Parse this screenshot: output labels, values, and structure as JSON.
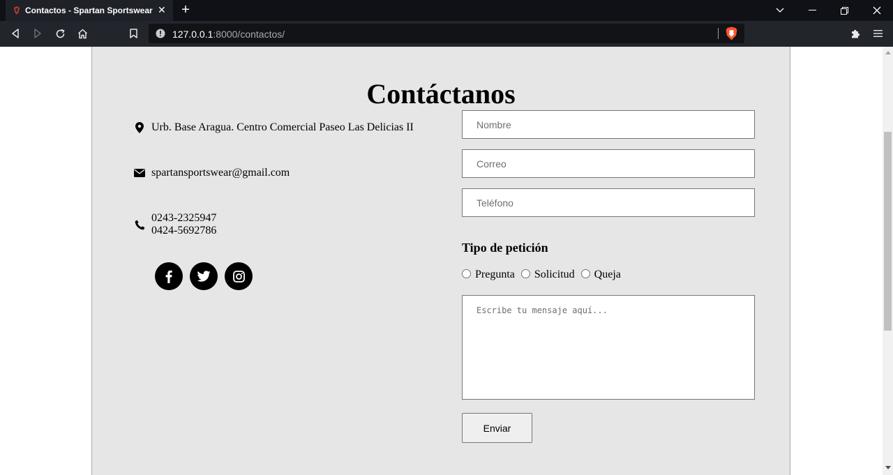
{
  "browser": {
    "tab_title": "Contactos - Spartan Sportswear",
    "url_host": "127.0.0.1",
    "url_rest": ":8000/contactos/"
  },
  "page": {
    "title": "Contáctanos",
    "address": "Urb. Base Aragua. Centro Comercial Paseo Las Delicias II",
    "email": "spartansportswear@gmail.com",
    "phones": [
      "0243-2325947",
      "0424-5692786"
    ],
    "social": [
      "facebook-icon",
      "twitter-icon",
      "instagram-icon"
    ]
  },
  "form": {
    "name_placeholder": "Nombre",
    "email_placeholder": "Correo",
    "phone_placeholder": "Teléfono",
    "petition_label": "Tipo de petición",
    "options": [
      "Pregunta",
      "Solicitud",
      "Queja"
    ],
    "message_placeholder": "Escribe tu mensaje aquí...",
    "submit_label": "Enviar"
  }
}
